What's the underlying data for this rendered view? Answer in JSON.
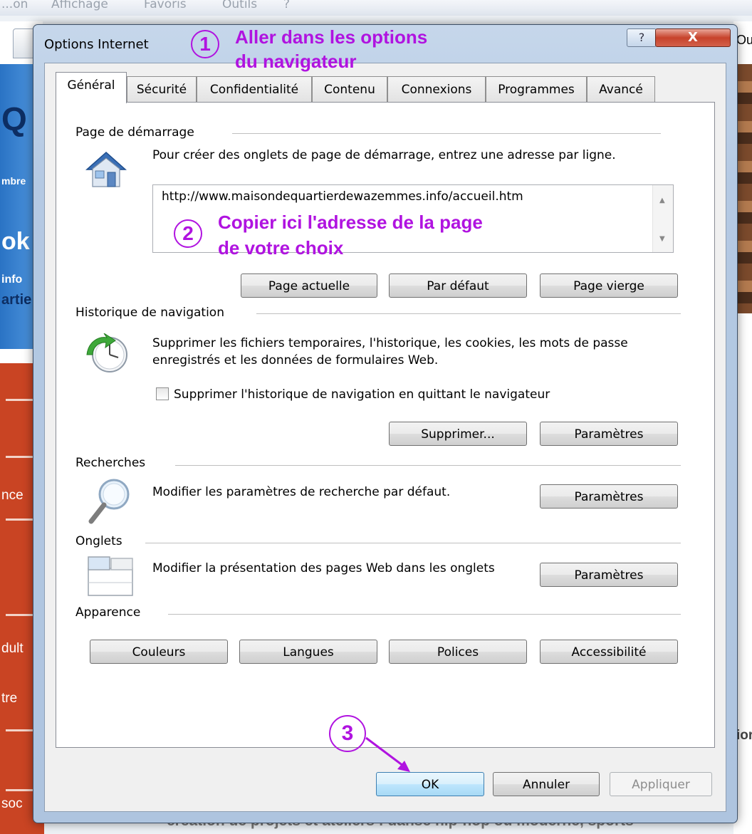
{
  "background": {
    "menubar": [
      "...on",
      "Affichage",
      "Favoris",
      "Outils",
      "?"
    ],
    "left_fragments": [
      "Q",
      "mbre",
      "ok",
      "info",
      "artie",
      "nce",
      "dult",
      "tre",
      "soc"
    ],
    "right_fragments": [
      "Ou",
      "ior"
    ],
    "bottom_text": "création de projets et ateliers : danse hip-hop ou moderne, sports"
  },
  "dialog": {
    "title": "Options Internet",
    "help_label": "?",
    "close_label": "X",
    "tabs": [
      {
        "label": "Général",
        "active": true
      },
      {
        "label": "Sécurité",
        "active": false
      },
      {
        "label": "Confidentialité",
        "active": false
      },
      {
        "label": "Contenu",
        "active": false
      },
      {
        "label": "Connexions",
        "active": false
      },
      {
        "label": "Programmes",
        "active": false
      },
      {
        "label": "Avancé",
        "active": false
      }
    ],
    "home": {
      "label": "Page de démarrage",
      "desc": "Pour créer des onglets de page de démarrage, entrez une adresse par ligne.",
      "url": "http://www.maisondequartierdewazemmes.info/accueil.htm",
      "buttons": [
        "Page actuelle",
        "Par défaut",
        "Page vierge"
      ],
      "icon": "house-icon"
    },
    "history": {
      "label": "Historique de navigation",
      "desc": "Supprimer les fichiers temporaires, l'historique, les cookies, les mots de passe enregistrés et les données de formulaires Web.",
      "checkbox_label": "Supprimer l'historique de navigation en quittant le navigateur",
      "checkbox_checked": false,
      "buttons": [
        "Supprimer...",
        "Paramètres"
      ],
      "icon": "history-clock-icon"
    },
    "search": {
      "label": "Recherches",
      "desc": "Modifier les paramètres de recherche par défaut.",
      "button": "Paramètres",
      "icon": "magnifier-icon"
    },
    "tabs_section": {
      "label": "Onglets",
      "desc": "Modifier la présentation des pages Web dans les onglets",
      "button": "Paramètres",
      "icon": "tabs-window-icon"
    },
    "appearance": {
      "label": "Apparence",
      "buttons": [
        "Couleurs",
        "Langues",
        "Polices",
        "Accessibilité"
      ]
    },
    "footer": {
      "ok": "OK",
      "cancel": "Annuler",
      "apply": "Appliquer"
    }
  },
  "annotations": {
    "step1_number": "1",
    "step1_text_line1": "Aller dans les options",
    "step1_text_line2": "du navigateur",
    "step2_number": "2",
    "step2_text_line1": "Copier ici l'adresse de la page",
    "step2_text_line2": "de votre choix",
    "step3_number": "3",
    "color": "#b013e0"
  },
  "colors": {
    "frame": "#b4c9e3",
    "close_button": "#c7432c",
    "annotation": "#b013e0",
    "default_button": "#bee6fd"
  }
}
